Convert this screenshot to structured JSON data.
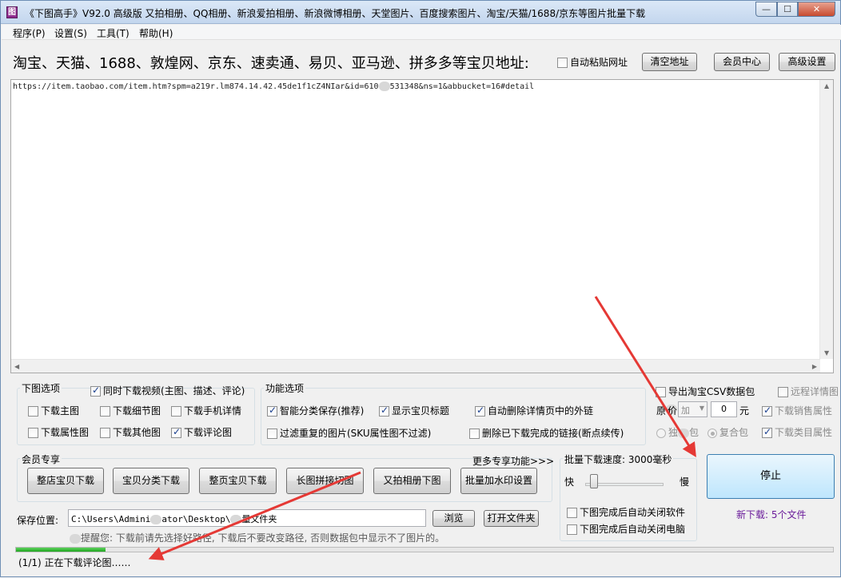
{
  "window": {
    "title": "《下图高手》V92.0 高级版  又拍相册、QQ相册、新浪爱拍相册、新浪微博相册、天堂图片、百度搜索图片、淘宝/天猫/1688/京东等图片批量下载",
    "min_glyph": "—",
    "max_glyph": "☐",
    "close_glyph": "✕"
  },
  "menu": [
    "程序(P)",
    "设置(S)",
    "工具(T)",
    "帮助(H)"
  ],
  "address": {
    "label": "淘宝、天猫、1688、敦煌网、京东、速卖通、易贝、亚马逊、拼多多等宝贝地址:",
    "auto_paste_label": "自动粘贴网址",
    "auto_paste_checked": false,
    "clear_button": "清空地址",
    "member_button": "会员中心",
    "advanced_button": "高级设置",
    "url_part1": "https://item.taobao.com/item.htm?spm=a219r.lm874.14.42.45de1f1cZ4NIar&id=610",
    "url_part2": "531348&ns=1&abbucket=16#detail"
  },
  "download_options": {
    "title": "下图选项",
    "video": {
      "label": "同时下载视频(主图、描述、评论)",
      "checked": true
    },
    "items": [
      {
        "label": "下载主图",
        "checked": false
      },
      {
        "label": "下载细节图",
        "checked": false
      },
      {
        "label": "下载手机详情",
        "checked": false
      },
      {
        "label": "下载属性图",
        "checked": false
      },
      {
        "label": "下载其他图",
        "checked": false
      },
      {
        "label": "下载评论图",
        "checked": true
      }
    ]
  },
  "function_options": {
    "title": "功能选项",
    "items": [
      {
        "label": "智能分类保存(推荐)",
        "checked": true
      },
      {
        "label": "显示宝贝标题",
        "checked": true
      },
      {
        "label": "自动删除详情页中的外链",
        "checked": true
      },
      {
        "label": "过滤重复的图片(SKU属性图不过滤)",
        "checked": false
      },
      {
        "label": "删除已下载完成的链接(断点续传)",
        "checked": false
      }
    ]
  },
  "csv": {
    "export_label": "导出淘宝CSV数据包",
    "export_checked": false,
    "remote_detail_label": "远程详情图",
    "price_label_a": "原",
    "price_label_b": "价",
    "price_op": "加",
    "price_value": "0",
    "price_unit": "元",
    "sales_attr_label": "下载销售属性",
    "sales_attr_checked": true,
    "single_pkg_a": "独",
    "single_pkg_b": "包",
    "combined_pkg": "复合包",
    "category_attr_label": "下载类目属性",
    "category_attr_checked": true
  },
  "member": {
    "title": "会员专享",
    "more": "更多专享功能>>>",
    "buttons": [
      "整店宝贝下载",
      "宝贝分类下载",
      "整页宝贝下载",
      "长图拼接切图",
      "又拍相册下图",
      "批量加水印设置"
    ]
  },
  "batch": {
    "title": "批量下载速度: 3000毫秒",
    "fast": "快",
    "slow": "慢",
    "speed_level": 0.08,
    "close_software": "下图完成后自动关闭软件",
    "shutdown": "下图完成后自动关闭电脑"
  },
  "save": {
    "label": "保存位置:",
    "path_a": "C:\\Users\\Admini",
    "path_b": "ator\\Desktop\\",
    "path_c": "量文件夹",
    "browse": "浏览",
    "open_folder": "打开文件夹",
    "tip": "提醒您: 下载前请先选择好路径, 下载后不要改变路径, 否则数据包中显示不了图片的。"
  },
  "stop_button": "停止",
  "new_download": "新下载: 5个文件",
  "progress": 0.11,
  "status": "(1/1) 正在下载评论图……",
  "colors": {
    "accent": "#3c7fb1",
    "new_download": "#6a1b9a",
    "arrow": "#e53935",
    "progress": "#1fa51f"
  }
}
